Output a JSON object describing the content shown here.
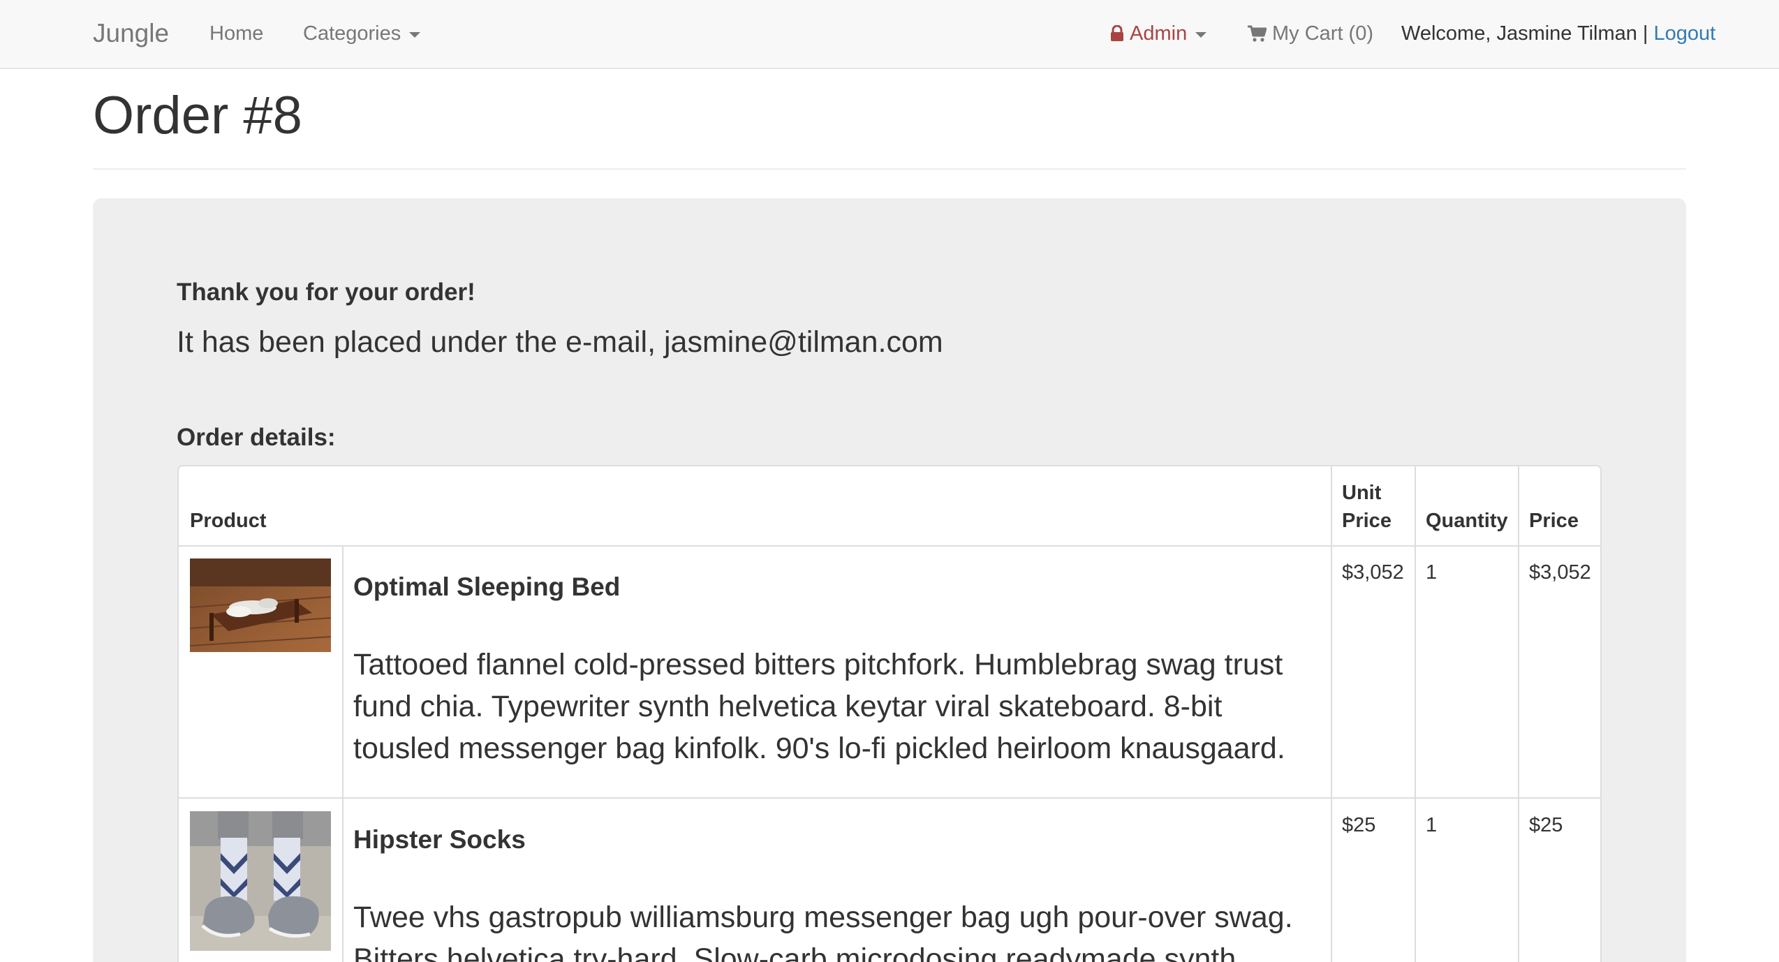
{
  "navbar": {
    "brand": "Jungle",
    "home": "Home",
    "categories": "Categories",
    "admin": "Admin",
    "cart": "My Cart (0)",
    "welcome": "Welcome, Jasmine Tilman",
    "separator": "|",
    "logout": "Logout"
  },
  "page": {
    "title": "Order #8"
  },
  "confirmation": {
    "heading": "Thank you for your order!",
    "message": "It has been placed under the e-mail, jasmine@tilman.com",
    "details_label": "Order details:"
  },
  "table": {
    "headers": {
      "product": "Product",
      "unit_price_line1": "Unit",
      "unit_price_line2": "Price",
      "quantity": "Quantity",
      "price": "Price"
    },
    "rows": [
      {
        "name": "Optimal Sleeping Bed",
        "description": "Tattooed flannel cold-pressed bitters pitchfork. Humblebrag swag trust fund chia. Typewriter synth helvetica keytar viral skateboard. 8-bit tousled messenger bag kinfolk. 90's lo-fi pickled heirloom knausgaard.",
        "unit_price": "$3,052",
        "quantity": "1",
        "price": "$3,052"
      },
      {
        "name": "Hipster Socks",
        "description": "Twee vhs gastropub williamsburg messenger bag ugh pour-over swag. Bitters helvetica try-hard. Slow-carb microdosing readymade synth",
        "unit_price": "$25",
        "quantity": "1",
        "price": "$25"
      }
    ]
  },
  "icons": {
    "admin": "lock-icon",
    "cart": "shopping-cart-icon",
    "dropdown": "caret-down-icon"
  },
  "colors": {
    "navbar_bg": "#f8f8f8",
    "admin_text": "#a94442",
    "link": "#337ab7",
    "jumbotron_bg": "#eeeeee"
  }
}
